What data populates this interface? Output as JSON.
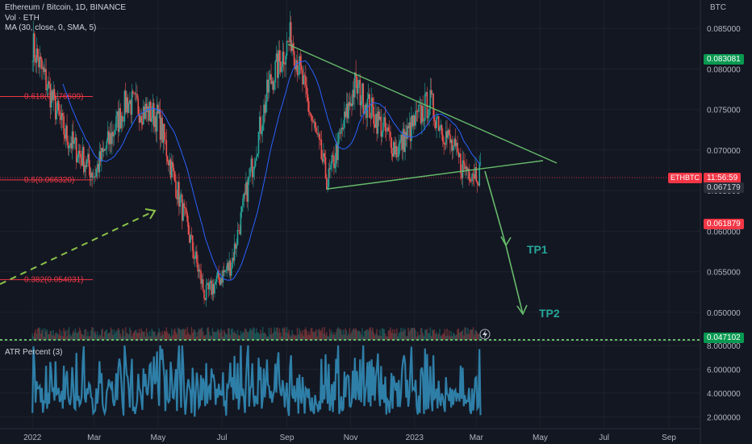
{
  "header": {
    "title": "Ethereum / Bitcoin, 1D, BINANCE",
    "volume": "Vol · ETH",
    "ma": "MA (30, close, 0, SMA, 5)"
  },
  "atr_label": "ATR Percent (3)",
  "price_axis": {
    "unit": "BTC",
    "ticks": [
      "0.085000",
      "0.080000",
      "0.075000",
      "0.070000",
      "0.065000",
      "0.060000",
      "0.055000",
      "0.050000"
    ],
    "atr_ticks": [
      "8.000000",
      "6.000000",
      "4.000000",
      "2.000000"
    ]
  },
  "price_tags": {
    "green_top": "0.083081",
    "symbol": "ETHBTC",
    "countdown": "11:56:59",
    "last": "0.067179",
    "red": "0.061879",
    "green_bottom": "0.047102"
  },
  "time_axis": [
    "2022",
    "Mar",
    "May",
    "Jul",
    "Sep",
    "Nov",
    "2023",
    "Mar",
    "May",
    "Jul",
    "Sep"
  ],
  "fib_levels": [
    {
      "label": "0.618(0.076609)",
      "value": 0.076609
    },
    {
      "label": "0.5(0.066320)",
      "value": 0.06632
    },
    {
      "label": "0.382(0.054031)",
      "value": 0.054031
    }
  ],
  "targets": [
    "TP1",
    "TP2"
  ],
  "colors": {
    "background": "#131722",
    "up": "#26a69a",
    "down": "#ef5350",
    "ma": "#2962ff",
    "trendline": "#66bb6a",
    "fib": "#f23645",
    "atr": "#2e7fa8",
    "tag_green": "#089950",
    "tag_red": "#f23645"
  },
  "chart_data": {
    "type": "candlestick",
    "y_range": [
      0.0465,
      0.0885
    ],
    "atr_range": [
      1.0,
      8.2
    ],
    "key_closes": [
      {
        "x": "2022-01-01",
        "y": 0.083
      },
      {
        "x": "2022-02-01",
        "y": 0.072
      },
      {
        "x": "2022-03-01",
        "y": 0.067
      },
      {
        "x": "2022-04-01",
        "y": 0.076
      },
      {
        "x": "2022-05-01",
        "y": 0.074
      },
      {
        "x": "2022-06-15",
        "y": 0.052
      },
      {
        "x": "2022-07-10",
        "y": 0.056
      },
      {
        "x": "2022-08-15",
        "y": 0.078
      },
      {
        "x": "2022-09-05",
        "y": 0.084
      },
      {
        "x": "2022-10-10",
        "y": 0.066
      },
      {
        "x": "2022-11-05",
        "y": 0.078
      },
      {
        "x": "2022-12-15",
        "y": 0.07
      },
      {
        "x": "2023-01-15",
        "y": 0.076
      },
      {
        "x": "2023-02-15",
        "y": 0.068
      },
      {
        "x": "2023-03-05",
        "y": 0.0672
      }
    ]
  }
}
